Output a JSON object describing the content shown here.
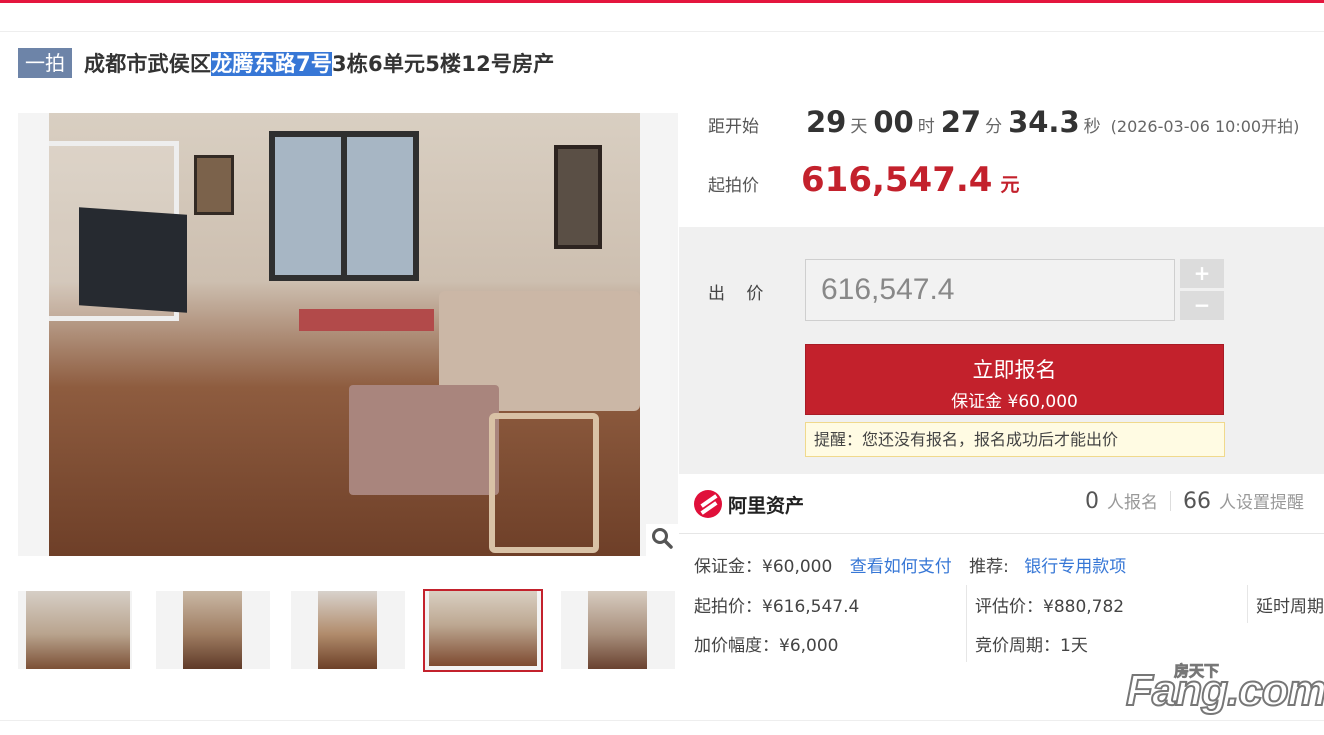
{
  "title": {
    "tag": "一拍",
    "prefix": "成都市武侯区",
    "highlight": "龙腾东路7号",
    "suffix": "3栋6单元5楼12号房产"
  },
  "countdown": {
    "label": "距开始",
    "days": "29",
    "days_unit": "天",
    "hours": "00",
    "hours_unit": "时",
    "minutes": "27",
    "minutes_unit": "分",
    "seconds": "34.3",
    "seconds_unit": "秒",
    "start_text": "(2026-03-06 10:00开拍)"
  },
  "start_price": {
    "label": "起拍价",
    "value": "616,547.4",
    "unit": "元"
  },
  "bid": {
    "label": "出 价",
    "value": "616,547.4",
    "plus": "+",
    "minus": "−",
    "signup_main": "立即报名",
    "signup_sub": "保证金 ¥60,000",
    "reminder": "提醒：您还没有报名，报名成功后才能出价"
  },
  "platform": {
    "name": "阿里资产",
    "signup_count": "0",
    "signup_text": "人报名",
    "remind_count": "66",
    "remind_text": "人设置提醒"
  },
  "info": {
    "deposit": "保证金：¥60,000",
    "pay_link": "查看如何支付",
    "recommend_label": "推荐:",
    "recommend_link": "银行专用款项",
    "start_price": "起拍价：¥616,547.4",
    "appraisal": "评估价：¥880,782",
    "delay": "延时周期",
    "increment": "加价幅度：¥6,000",
    "cycle": "竞价周期：1天"
  },
  "watermark": {
    "main": "Fang.com",
    "sub": "房天下"
  },
  "colors": {
    "accent_red": "#c3212c",
    "top_line": "#e4163e",
    "link_blue": "#3777d6",
    "tag_bg": "#6d84a8"
  }
}
